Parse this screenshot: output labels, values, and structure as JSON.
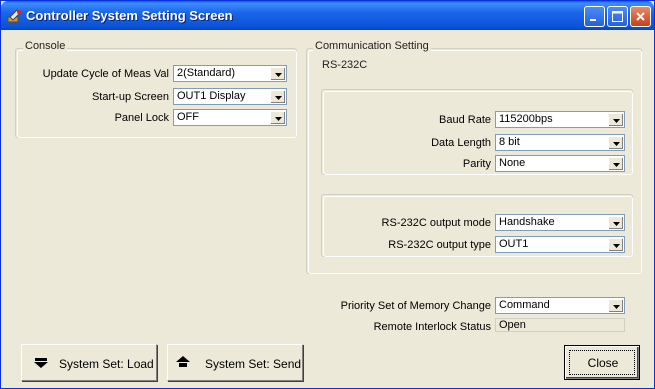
{
  "window": {
    "title": "Controller System Setting Screen",
    "titlebar_color": "#0B53D8"
  },
  "console": {
    "group_label": "Console",
    "update_cycle": {
      "label": "Update Cycle of Meas Val",
      "value": "2(Standard)"
    },
    "startup_screen": {
      "label": "Start-up Screen",
      "value": "OUT1 Display"
    },
    "panel_lock": {
      "label": "Panel Lock",
      "value": "OFF"
    }
  },
  "communication": {
    "group_label": "Communication Setting",
    "rs232c": {
      "group_label": "RS-232C",
      "baud_rate": {
        "label": "Baud Rate",
        "value": "115200bps"
      },
      "data_length": {
        "label": "Data Length",
        "value": "8 bit"
      },
      "parity": {
        "label": "Parity",
        "value": "None"
      },
      "output_mode": {
        "label": "RS-232C output mode",
        "value": "Handshake"
      },
      "output_type": {
        "label": "RS-232C output type",
        "value": "OUT1"
      }
    }
  },
  "priority_memory": {
    "label": "Priority Set of Memory Change",
    "value": "Command"
  },
  "remote_interlock": {
    "label": "Remote Interlock Status",
    "value": "Open"
  },
  "buttons": {
    "load": "System Set: Load",
    "send": "System Set: Send",
    "close": "Close"
  },
  "icons": {
    "app": "tool-icon",
    "minimize": "minimize-icon",
    "maximize": "maximize-icon",
    "close": "close-icon",
    "load": "arrow-down-icon",
    "send": "arrow-up-icon"
  }
}
